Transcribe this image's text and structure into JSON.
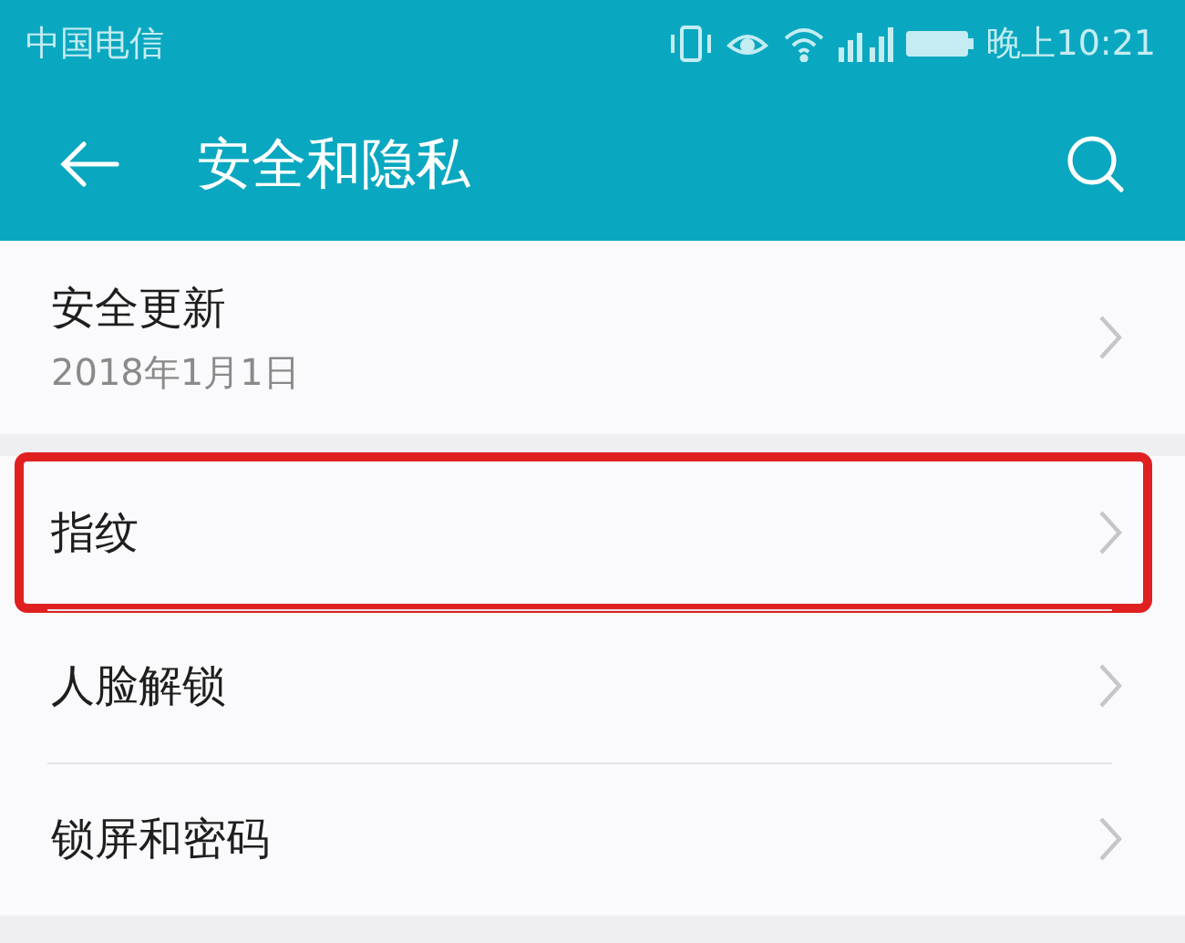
{
  "status_bar": {
    "carrier": "中国电信",
    "time": "晚上10:21"
  },
  "app_bar": {
    "title": "安全和隐私"
  },
  "groups": [
    {
      "items": [
        {
          "title": "安全更新",
          "subtitle": "2018年1月1日",
          "highlighted": false
        }
      ]
    },
    {
      "items": [
        {
          "title": "指纹",
          "highlighted": true
        },
        {
          "title": "人脸解锁",
          "highlighted": false
        },
        {
          "title": "锁屏和密码",
          "highlighted": false
        }
      ]
    }
  ]
}
